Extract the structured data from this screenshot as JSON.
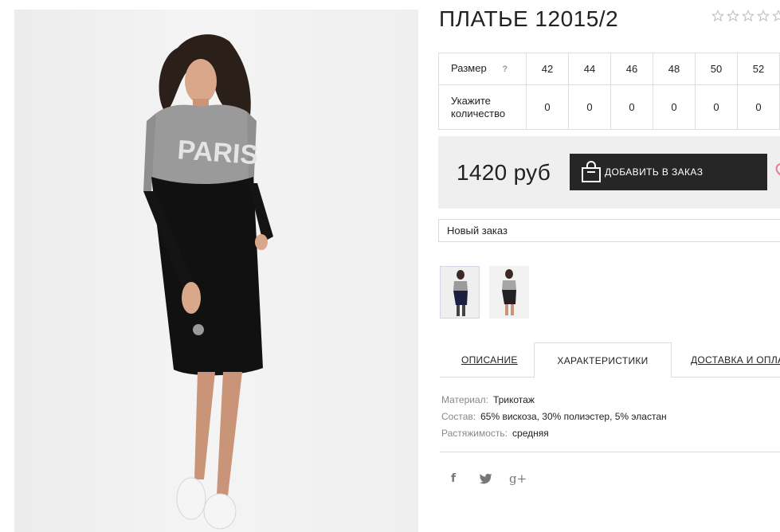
{
  "product": {
    "title": "ПЛАТЬЕ 12015/2",
    "rating": {
      "value": 0,
      "max": 5
    },
    "price": "1420 руб"
  },
  "size_table": {
    "size_label": "Размер",
    "help_icon": "?",
    "qty_label": "Укажите количество",
    "sizes": [
      "42",
      "44",
      "46",
      "48",
      "50",
      "52"
    ],
    "quantities": [
      "0",
      "0",
      "0",
      "0",
      "0",
      "0"
    ]
  },
  "actions": {
    "order_button_label": "ДОБАВИТЬ В ЗАКАЗ",
    "order_select_value": "Новый заказ"
  },
  "main_image": {
    "print_text": "PARIS"
  },
  "tabs": [
    {
      "label": "ОПИСАНИЕ",
      "active": false
    },
    {
      "label": "ХАРАКТЕРИСТИКИ",
      "active": true
    },
    {
      "label": "ДОСТАВКА И ОПЛАТА",
      "active": false
    }
  ],
  "specs": [
    {
      "label": "Материал:",
      "value": "Трикотаж"
    },
    {
      "label": "Состав:",
      "value": "65% вискоза, 30% полиэстер, 5% эластан"
    },
    {
      "label": "Растяжимость:",
      "value": "средняя"
    }
  ],
  "social": {
    "facebook": "f",
    "twitter": "twitter-icon",
    "google_plus": "g+"
  },
  "colors": {
    "button_bg": "#262626",
    "price_box_bg": "#efefef",
    "border": "#dedede",
    "heart": "#e77a8f"
  }
}
